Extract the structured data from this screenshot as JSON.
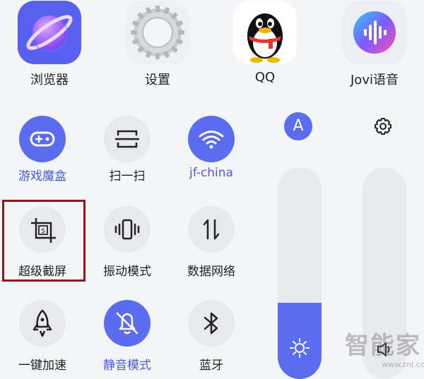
{
  "apps": [
    {
      "label": "浏览器",
      "icon": "browser-planet-icon"
    },
    {
      "label": "设置",
      "icon": "settings-gear-icon"
    },
    {
      "label": "QQ",
      "icon": "qq-penguin-icon"
    },
    {
      "label": "Jovi语音",
      "icon": "jovi-voice-icon"
    }
  ],
  "tiles": [
    {
      "label": "游戏魔盒",
      "state": "on",
      "icon": "gamepad-icon"
    },
    {
      "label": "扫一扫",
      "state": "off",
      "icon": "scan-icon"
    },
    {
      "label": "jf-china",
      "state": "on",
      "icon": "wifi-icon"
    },
    {
      "label": "超级截屏",
      "state": "off",
      "icon": "crop-screenshot-icon",
      "highlighted": true
    },
    {
      "label": "振动模式",
      "state": "off",
      "icon": "vibrate-icon"
    },
    {
      "label": "数据网络",
      "state": "off",
      "icon": "mobile-data-icon"
    },
    {
      "label": "一键加速",
      "state": "off",
      "icon": "rocket-icon"
    },
    {
      "label": "静音模式",
      "state": "on",
      "icon": "bell-off-icon"
    },
    {
      "label": "蓝牙",
      "state": "off",
      "icon": "bluetooth-icon"
    }
  ],
  "auto_brightness": {
    "label": "A",
    "state": "on"
  },
  "brightness_slider": {
    "level": 0.36,
    "icon": "sun-icon"
  },
  "volume_slider": {
    "level": 0.0,
    "icon": "speaker-icon"
  },
  "volume_settings_icon": "gear-icon",
  "watermark": {
    "text": "智能家",
    "sub": "www.znj.com"
  },
  "colors": {
    "accent": "#5a6cf0",
    "tile_off": "#e8e9ec",
    "background": "#f4f5f7",
    "highlight_border": "#8b1a1a"
  }
}
